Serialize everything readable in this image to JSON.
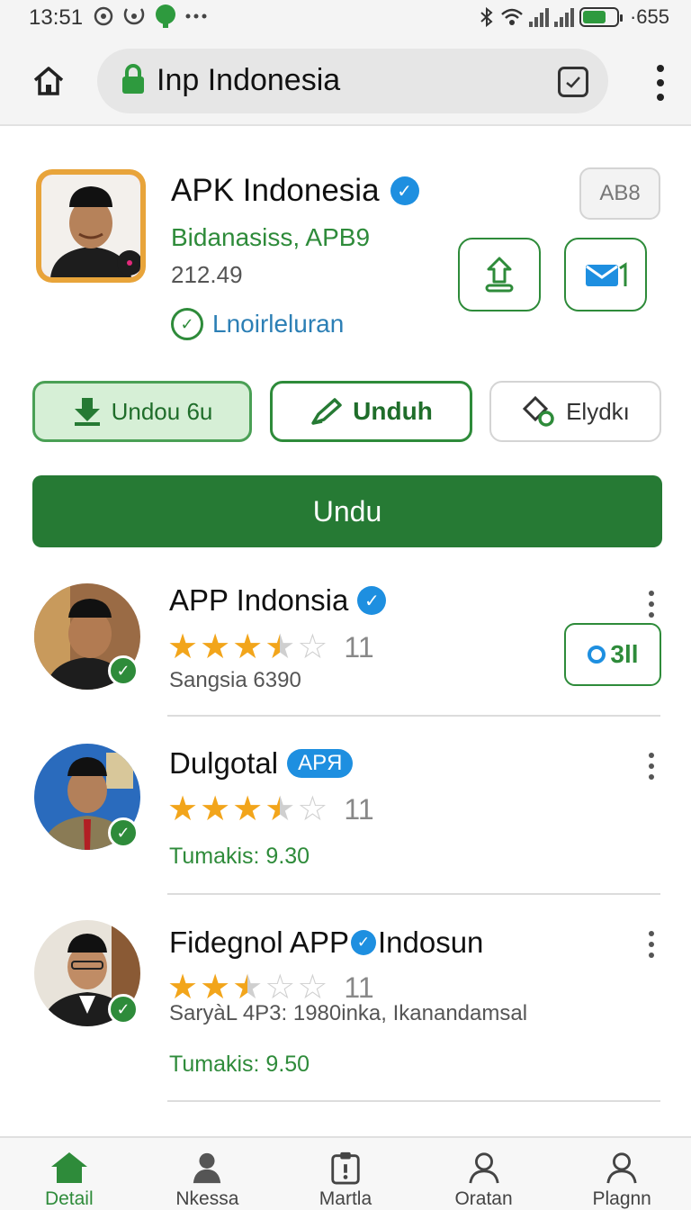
{
  "status_bar": {
    "time": "13:51",
    "right_text": "·655",
    "icons": [
      "bluetooth-icon",
      "wifi-icon",
      "signal-icon",
      "battery-icon"
    ]
  },
  "browser": {
    "url_title": "Inp Indonesia"
  },
  "app": {
    "title": "APK Indonesia",
    "subtitle": "Bidanasiss, APB9",
    "size": "212.49",
    "status": "Lnoirleluran",
    "tag": "AB8"
  },
  "chips": {
    "one": "Undou 6u",
    "two": "Unduh",
    "three": "Elydkı"
  },
  "main_button": "Undu",
  "items": [
    {
      "title": "APP Indonsia",
      "rating": 3.5,
      "rating_count": "11",
      "meta": "Sangsia 6390",
      "action": "3ll"
    },
    {
      "title": "Dulgotal",
      "badge": "APЯ",
      "rating": 3.5,
      "rating_count": "11",
      "green": "Tumakis: 9.30"
    },
    {
      "title_a": "Fidegnol APP",
      "title_b": "Indosun",
      "rating": 2.5,
      "rating_count": "11",
      "meta": "SaryàL 4P3: 1980inka, Ikanandamsal",
      "green": "Tumakis: 9.50"
    }
  ],
  "nav": [
    {
      "label": "Detail",
      "icon": "home-icon",
      "active": true
    },
    {
      "label": "Nkessa",
      "icon": "person-icon",
      "active": false
    },
    {
      "label": "Martla",
      "icon": "clipboard-icon",
      "active": false
    },
    {
      "label": "Oratan",
      "icon": "person-icon",
      "active": false
    },
    {
      "label": "Plagnn",
      "icon": "person-icon",
      "active": false
    }
  ],
  "colors": {
    "brand_green": "#267a34",
    "accent_blue": "#1e8fe0",
    "star": "#f2a51b"
  }
}
